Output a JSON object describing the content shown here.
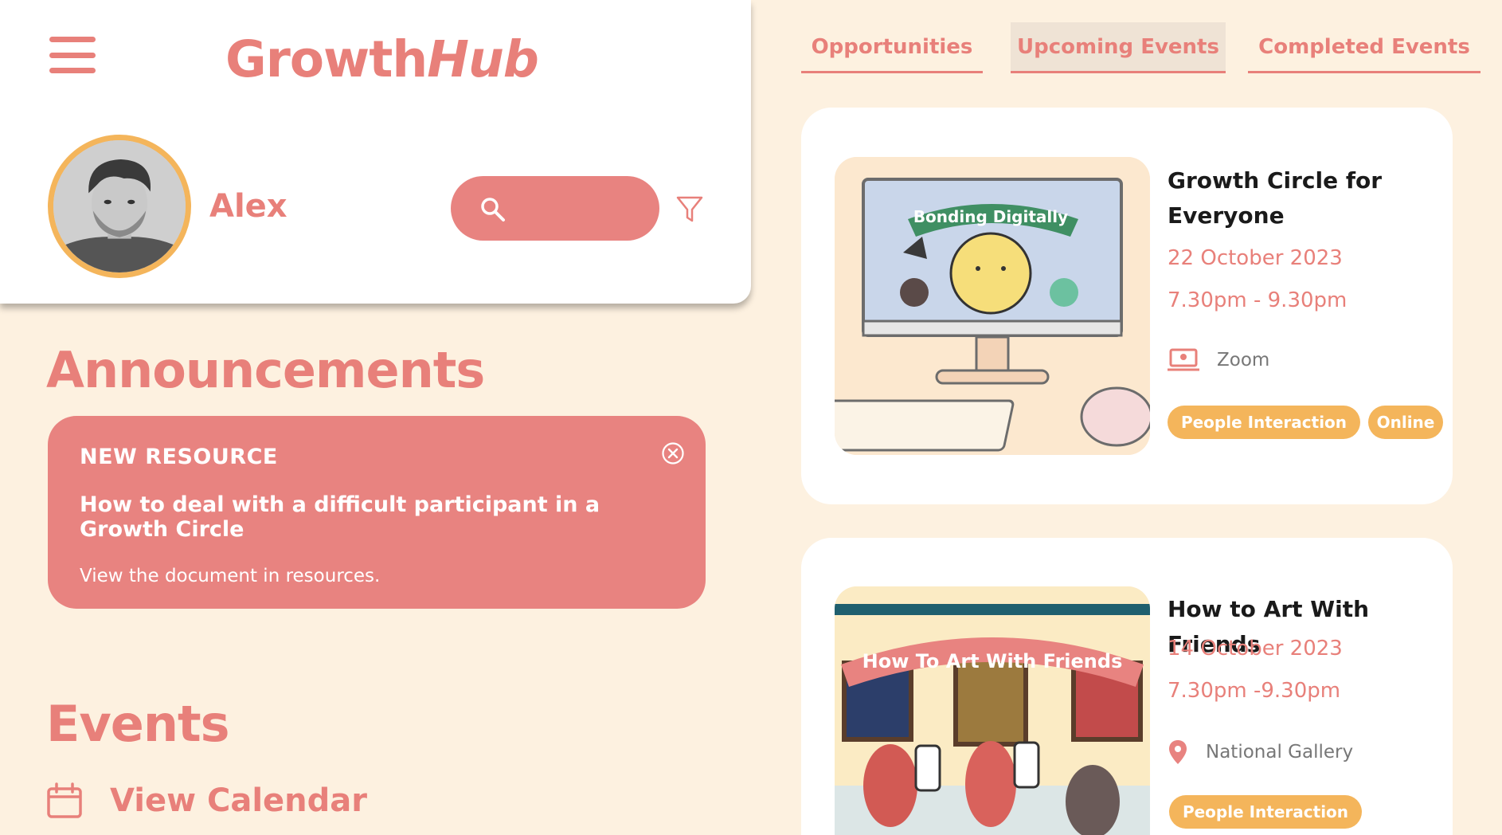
{
  "app": {
    "brand_main": "Growth",
    "brand_italic": "Hub"
  },
  "user": {
    "name": "Alex"
  },
  "search": {
    "placeholder": ""
  },
  "announcements": {
    "title": "Announcements",
    "card": {
      "kicker": "NEW RESOURCE",
      "heading": "How to deal with a difficult participant in a Growth Circle",
      "body": "View the document in resources."
    }
  },
  "events_section": {
    "title": "Events",
    "calendar_link": "View Calendar"
  },
  "tabs": [
    {
      "label": "Opportunities",
      "active": false
    },
    {
      "label": "Upcoming Events",
      "active": true
    },
    {
      "label": "Completed Events",
      "active": false
    }
  ],
  "events": [
    {
      "title": "Growth Circle for Everyone",
      "date": "22 October 2023",
      "time": "7.30pm - 9.30pm",
      "location": "Zoom",
      "location_icon": "laptop-icon",
      "image_banner": "Bonding Digitally",
      "tags": [
        "People Interaction",
        "Online"
      ]
    },
    {
      "title": "How to Art With Friends",
      "date": "14 October 2023",
      "time": "7.30pm -9.30pm",
      "location": "National Gallery",
      "location_icon": "map-pin-icon",
      "image_banner": "How To Art With Friends",
      "tags": [
        "People Interaction"
      ]
    }
  ],
  "colors": {
    "accent": "#E8807A",
    "accent_fill": "#E88380",
    "tag": "#F4B55B",
    "background": "#FDF1E0",
    "card": "#FFFFFF",
    "active_tab": "#EFE3D5"
  }
}
